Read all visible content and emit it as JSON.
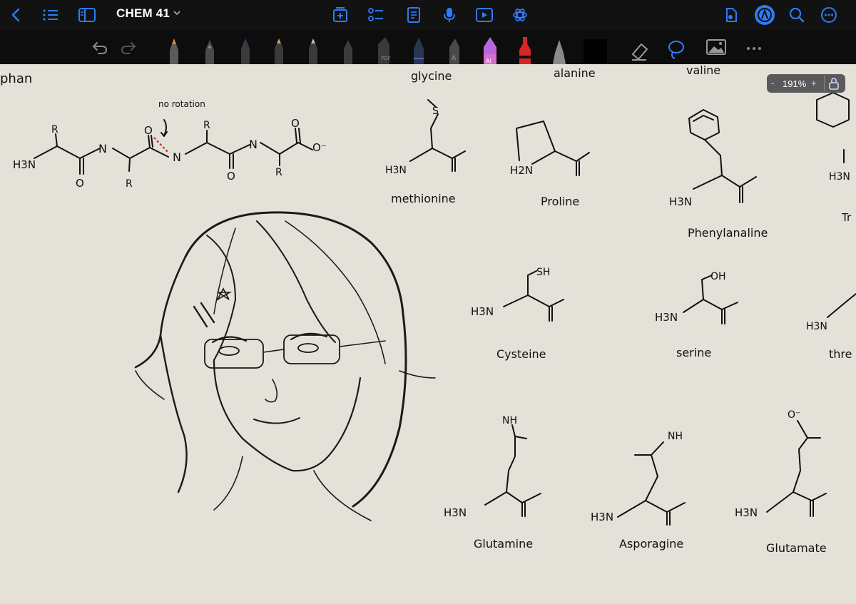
{
  "app": {
    "document_title": "CHEM 41",
    "zoom_level": "191%",
    "zoom_minus": "-",
    "zoom_plus": "+"
  },
  "colors": {
    "accent": "#2f7bf6",
    "top_bar": "#121212",
    "tool_bar": "#0d0d0d",
    "paper": "#e4e1d8",
    "ink": "#111111",
    "red_ink": "#c0392b"
  },
  "top_bar": {
    "left_icons": [
      "chevron-left-icon",
      "list-icon",
      "sidebar-icon"
    ],
    "center_icons": [
      "add-page-icon",
      "outline-icon",
      "document-icon",
      "microphone-icon",
      "play-icon",
      "ai-assistant-icon"
    ],
    "right_icons": [
      "share-icon",
      "pen-mode-icon",
      "search-icon",
      "more-icon"
    ]
  },
  "tool_bar": {
    "icons": [
      "undo-icon",
      "redo-icon",
      "pen-orange-tool",
      "pen-gray-tool",
      "pen-blue-tool",
      "pen-tan-tool",
      "pen-light-tool",
      "pen-dark-tool",
      "pdf-marker-tool",
      "pen-navy-tool",
      "highlighter-tool",
      "ai-pen-tool",
      "pen-red-tool",
      "brush-tool",
      "color-swatch",
      "eraser-icon",
      "lasso-icon",
      "image-icon",
      "more-dots-icon"
    ]
  },
  "notes": {
    "top_left_fragment": "phan",
    "no_rotation_label": "no rotation",
    "peptide_chain": {
      "h3n": "H3N",
      "n": "N",
      "r": "R",
      "o": "O",
      "o_minus": "O⁻"
    },
    "headers": [
      "glycine",
      "alanine",
      "valine"
    ],
    "amino_acids": [
      {
        "name": "methionine",
        "formula_left": "H3N",
        "side": "S"
      },
      {
        "name": "Proline",
        "formula_left": "H2N"
      },
      {
        "name": "Phenylanaline",
        "formula_left": "H3N"
      },
      {
        "name": "Cysteine",
        "formula_left": "H3N",
        "side": "SH"
      },
      {
        "name": "serine",
        "formula_left": "H3N",
        "side": "OH"
      },
      {
        "name": "Glutamine",
        "formula_left": "H3N",
        "side": "NH"
      },
      {
        "name": "Asporagine",
        "formula_left": "H3N",
        "side": "NH"
      },
      {
        "name": "Glutamate",
        "formula_left": "H3N",
        "side": "O⁻"
      }
    ],
    "partial_right": [
      "Tr",
      "thre",
      "H3N",
      "H3N"
    ]
  }
}
